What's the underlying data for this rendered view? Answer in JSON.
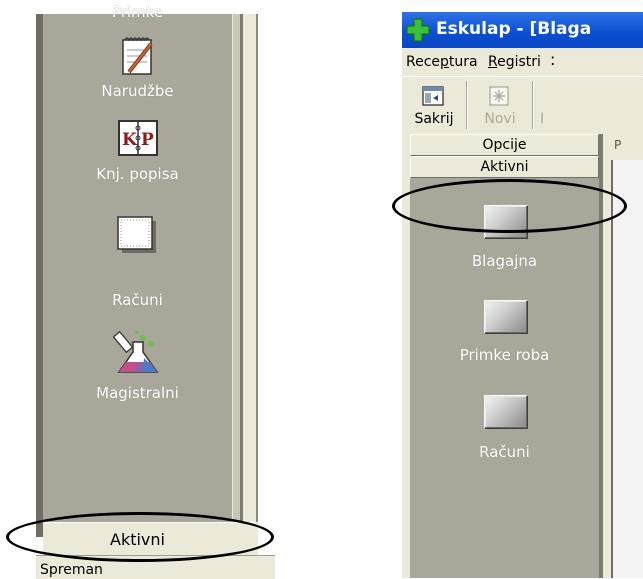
{
  "left_panel": {
    "items": [
      {
        "label": "Primke",
        "icon": "receipt-icon"
      },
      {
        "label": "Narudžbe",
        "icon": "notepad-pencil-icon"
      },
      {
        "label": "Knj. popisa",
        "icon": "kp-book-icon"
      },
      {
        "label": "Računi",
        "icon": "invoice-page-icon"
      },
      {
        "label": "Magistralni",
        "icon": "lab-flask-icon"
      }
    ],
    "group_bar": "Aktivni",
    "status": "Spreman"
  },
  "right_panel": {
    "title": "Eskulap - [Blaga",
    "menu": [
      "Receptura",
      "Registri"
    ],
    "menu_mnemonics": [
      "p",
      "R"
    ],
    "toolbar": [
      {
        "label": "Sakrij",
        "enabled": true,
        "icon": "hide-panel-icon"
      },
      {
        "label": "Novi",
        "enabled": false,
        "icon": "new-star-icon"
      }
    ],
    "groups": [
      "Opcije",
      "Aktivni"
    ],
    "content_tab": "P",
    "items": [
      {
        "label": "Blagajna",
        "icon": "gray-button-icon"
      },
      {
        "label": "Primke roba",
        "icon": "gray-button-icon"
      },
      {
        "label": "Računi",
        "icon": "gray-button-icon"
      }
    ]
  },
  "colors": {
    "sidebar": "#a9a79a",
    "chrome": "#ece9d8",
    "title_bar": "#0b4ed1",
    "highlight_ellipse": "#000000"
  }
}
